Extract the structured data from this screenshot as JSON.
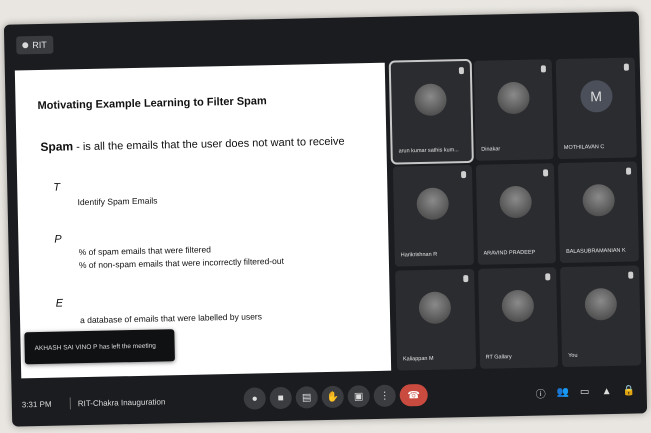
{
  "presenter_chip": {
    "label": "RIT"
  },
  "slide": {
    "title": "Motivating Example Learning to Filter Spam",
    "definition_term": "Spam",
    "definition_rest": " - is all the emails that the user does not want to receive",
    "t_letter": "T",
    "t_text": "Identify Spam Emails",
    "p_letter": "P",
    "p_line1": "% of spam emails that were filtered",
    "p_line2": "% of non-spam emails that were incorrectly filtered-out",
    "e_letter": "E",
    "e_text": "a database of emails that were labelled by users"
  },
  "toast": {
    "text": "AKHASH SAI VINO P has left the meeting"
  },
  "participants": [
    {
      "name": "arun kumar sathis kum...",
      "avatar": "photo"
    },
    {
      "name": "Dinakar",
      "avatar": "photo"
    },
    {
      "name": "MOTHILAVAN C",
      "avatar": "M"
    },
    {
      "name": "Harikrishnan R",
      "avatar": "photo"
    },
    {
      "name": "ARAVIND PRADEEP",
      "avatar": "photo"
    },
    {
      "name": "BALASUBRAMANIAN K",
      "avatar": "photo"
    },
    {
      "name": "Kaliappan M",
      "avatar": "photo"
    },
    {
      "name": "RT Gallary",
      "avatar": "photo"
    },
    {
      "name": "You",
      "avatar": "photo"
    }
  ],
  "bottombar": {
    "time": "3:31 PM",
    "meeting_name": "RIT-Chakra Inauguration"
  },
  "icons": {
    "mic": "mic-icon",
    "camera": "camera-icon",
    "captions": "captions-icon",
    "hand": "raise-hand-icon",
    "present": "present-icon",
    "more": "more-icon",
    "end": "end-call-icon"
  }
}
